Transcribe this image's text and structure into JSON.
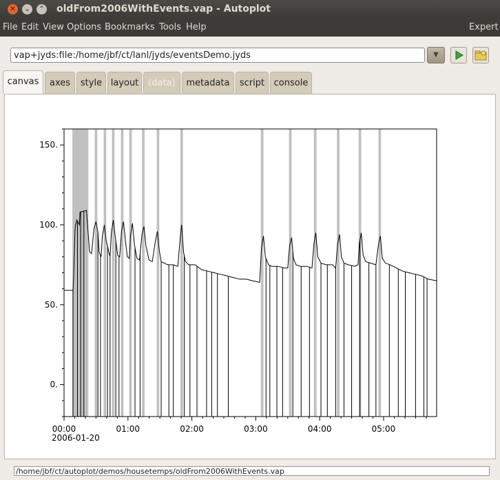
{
  "window": {
    "title": "oldFrom2006WithEvents.vap - Autoplot"
  },
  "menu": {
    "items": [
      "File",
      "Edit",
      "View",
      "Options",
      "Bookmarks",
      "Tools",
      "Help"
    ],
    "right": "Expert"
  },
  "uri_field": {
    "value": "vap+jyds:file:/home/jbf/ct/lanl/jyds/eventsDemo.jyds"
  },
  "tabs": [
    {
      "label": "canvas",
      "state": "active"
    },
    {
      "label": "axes",
      "state": "normal"
    },
    {
      "label": "style",
      "state": "normal"
    },
    {
      "label": "layout",
      "state": "normal"
    },
    {
      "label": "(data)",
      "state": "disabled"
    },
    {
      "label": "metadata",
      "state": "normal"
    },
    {
      "label": "script",
      "state": "normal"
    },
    {
      "label": "console",
      "state": "normal"
    }
  ],
  "status": {
    "path": "/home/jbf/ct/autoplot/demos/housetemps/oldFrom2006WithEvents.vap"
  },
  "chart_data": {
    "type": "line",
    "date_label": "2006-01-20",
    "xlim_hours": [
      0,
      5.83
    ],
    "ylim": [
      -20,
      160
    ],
    "yticks": [
      "0.",
      "50.",
      "100.",
      "150."
    ],
    "ytick_values": [
      0,
      50,
      100,
      150
    ],
    "xticks": [
      "00:00",
      "01:00",
      "02:00",
      "03:00",
      "04:00",
      "05:00"
    ],
    "xtick_values": [
      0,
      1,
      2,
      3,
      4,
      5
    ],
    "event_color": "#c0c0c0",
    "line_color": "#000000",
    "events_hours": [
      [
        0.13,
        0.38
      ],
      [
        0.48,
        0.52
      ],
      [
        0.62,
        0.66
      ],
      [
        0.75,
        0.79
      ],
      [
        0.89,
        0.93
      ],
      [
        1.02,
        1.06
      ],
      [
        1.22,
        1.26
      ],
      [
        1.45,
        1.49
      ],
      [
        1.82,
        1.86
      ],
      [
        3.08,
        3.12
      ],
      [
        3.52,
        3.56
      ],
      [
        3.91,
        3.95
      ],
      [
        4.27,
        4.31
      ],
      [
        4.61,
        4.65
      ],
      [
        4.92,
        4.96
      ]
    ],
    "series_points": [
      [
        0.0,
        59
      ],
      [
        0.14,
        59
      ],
      [
        0.15,
        66
      ],
      [
        0.17,
        96
      ],
      [
        0.18,
        100
      ],
      [
        0.2,
        103
      ],
      [
        0.24,
        100
      ],
      [
        0.25,
        108
      ],
      [
        0.35,
        109
      ],
      [
        0.4,
        83
      ],
      [
        0.43,
        82
      ],
      [
        0.47,
        98
      ],
      [
        0.5,
        102
      ],
      [
        0.53,
        95
      ],
      [
        0.55,
        83
      ],
      [
        0.58,
        80
      ],
      [
        0.6,
        93
      ],
      [
        0.63,
        100
      ],
      [
        0.66,
        90
      ],
      [
        0.7,
        83
      ],
      [
        0.72,
        80
      ],
      [
        0.74,
        95
      ],
      [
        0.77,
        103
      ],
      [
        0.8,
        93
      ],
      [
        0.84,
        81
      ],
      [
        0.87,
        80
      ],
      [
        0.9,
        96
      ],
      [
        0.93,
        102
      ],
      [
        0.96,
        90
      ],
      [
        0.99,
        80
      ],
      [
        1.02,
        79
      ],
      [
        1.04,
        93
      ],
      [
        1.07,
        101
      ],
      [
        1.1,
        88
      ],
      [
        1.14,
        79
      ],
      [
        1.18,
        78
      ],
      [
        1.22,
        94
      ],
      [
        1.25,
        99
      ],
      [
        1.28,
        87
      ],
      [
        1.33,
        78
      ],
      [
        1.38,
        77
      ],
      [
        1.43,
        90
      ],
      [
        1.46,
        96
      ],
      [
        1.49,
        84
      ],
      [
        1.52,
        77
      ],
      [
        1.57,
        76
      ],
      [
        1.62,
        75
      ],
      [
        1.7,
        75
      ],
      [
        1.78,
        74
      ],
      [
        1.82,
        93
      ],
      [
        1.84,
        100
      ],
      [
        1.87,
        83
      ],
      [
        1.9,
        77
      ],
      [
        1.95,
        75
      ],
      [
        2.05,
        75
      ],
      [
        2.15,
        72
      ],
      [
        2.25,
        71
      ],
      [
        2.35,
        70
      ],
      [
        2.45,
        69
      ],
      [
        2.55,
        68
      ],
      [
        2.65,
        67
      ],
      [
        2.75,
        66
      ],
      [
        2.85,
        66
      ],
      [
        2.95,
        65
      ],
      [
        3.06,
        64
      ],
      [
        3.09,
        86
      ],
      [
        3.12,
        93
      ],
      [
        3.15,
        80
      ],
      [
        3.2,
        75
      ],
      [
        3.25,
        74
      ],
      [
        3.35,
        74
      ],
      [
        3.45,
        73
      ],
      [
        3.5,
        73
      ],
      [
        3.53,
        87
      ],
      [
        3.56,
        92
      ],
      [
        3.59,
        79
      ],
      [
        3.63,
        75
      ],
      [
        3.7,
        74
      ],
      [
        3.8,
        74
      ],
      [
        3.88,
        73
      ],
      [
        3.91,
        88
      ],
      [
        3.94,
        95
      ],
      [
        3.97,
        80
      ],
      [
        4.02,
        76
      ],
      [
        4.1,
        75
      ],
      [
        4.2,
        75
      ],
      [
        4.25,
        73
      ],
      [
        4.28,
        88
      ],
      [
        4.31,
        94
      ],
      [
        4.34,
        80
      ],
      [
        4.38,
        76
      ],
      [
        4.45,
        75
      ],
      [
        4.55,
        74
      ],
      [
        4.6,
        75
      ],
      [
        4.62,
        88
      ],
      [
        4.65,
        95
      ],
      [
        4.68,
        81
      ],
      [
        4.72,
        77
      ],
      [
        4.8,
        76
      ],
      [
        4.88,
        75
      ],
      [
        4.92,
        88
      ],
      [
        4.95,
        93
      ],
      [
        4.98,
        79
      ],
      [
        5.03,
        76
      ],
      [
        5.1,
        75
      ],
      [
        5.2,
        73
      ],
      [
        5.3,
        71
      ],
      [
        5.4,
        70
      ],
      [
        5.5,
        69
      ],
      [
        5.6,
        68
      ],
      [
        5.7,
        66
      ],
      [
        5.83,
        65
      ]
    ],
    "spike_hours": [
      0.14,
      0.21,
      0.26,
      0.31,
      0.53,
      0.57,
      0.68,
      0.72,
      0.81,
      0.86,
      1.11,
      1.19,
      1.52,
      1.64,
      1.71,
      1.88,
      1.97,
      2.08,
      2.23,
      2.31,
      2.4,
      2.57,
      3.16,
      3.22,
      3.33,
      3.42,
      3.58,
      3.71,
      3.84,
      4.02,
      4.12,
      4.25,
      4.38,
      4.5,
      4.63,
      4.77,
      4.88,
      5.09,
      5.23,
      5.34,
      5.5,
      5.63,
      5.68
    ]
  }
}
